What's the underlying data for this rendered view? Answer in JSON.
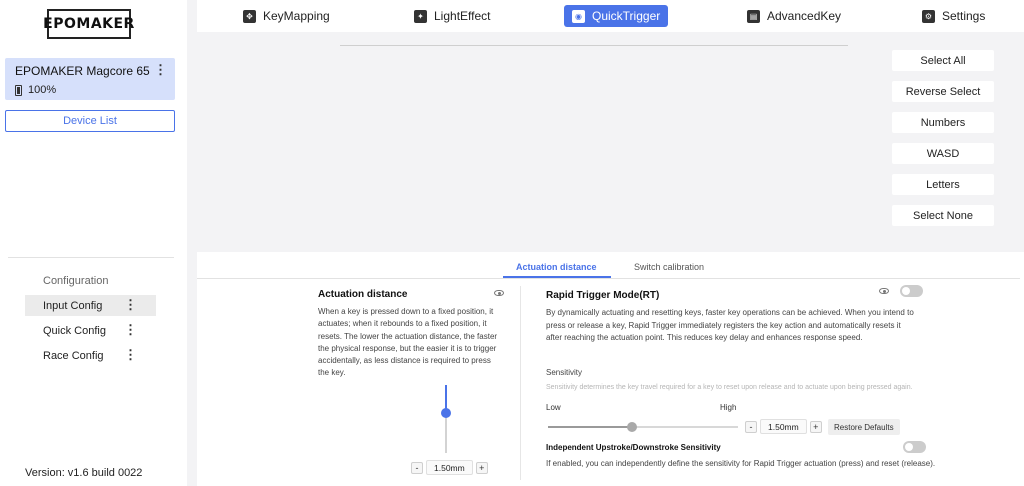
{
  "sidebar": {
    "logo": "EPOMAKER",
    "device": {
      "name": "EPOMAKER Magcore 65",
      "battery": "100%"
    },
    "device_list_label": "Device List",
    "config_title": "Configuration",
    "configs": [
      {
        "label": "Input Config"
      },
      {
        "label": "Quick Config"
      },
      {
        "label": "Race Config"
      }
    ],
    "version": "Version: v1.6 build 0022"
  },
  "nav": {
    "tabs": [
      {
        "label": "KeyMapping",
        "icon": "keymapping-icon"
      },
      {
        "label": "LightEffect",
        "icon": "lighteffect-icon"
      },
      {
        "label": "QuickTrigger",
        "icon": "quicktrigger-icon"
      },
      {
        "label": "AdvancedKey",
        "icon": "keyboard-icon"
      },
      {
        "label": "Settings",
        "icon": "gear-icon"
      }
    ],
    "active": "QuickTrigger"
  },
  "selection": {
    "buttons": [
      "Select All",
      "Reverse Select",
      "Numbers",
      "WASD",
      "Letters",
      "Select None"
    ]
  },
  "subtabs": [
    "Actuation distance",
    "Switch calibration"
  ],
  "actuation": {
    "title": "Actuation distance",
    "description": "When a key is pressed down to a fixed position, it actuates; when it rebounds to a fixed position, it resets. The lower the actuation distance, the faster the physical response, but the easier it is to trigger accidentally, as less distance is required to press the key.",
    "value": "1.50mm",
    "level": 0.42
  },
  "rapid_trigger": {
    "title": "Rapid Trigger Mode(RT)",
    "description": "By dynamically actuating and resetting keys, faster key operations can be achieved. When you intend to press or release a key, Rapid Trigger immediately registers the key action and automatically resets it after reaching the actuation point. This reduces key delay and enhances response speed.",
    "enabled": false,
    "sensitivity_label": "Sensitivity",
    "sensitivity_desc": "Sensitivity determines the key travel required for a key to reset upon release and to actuate upon being pressed again.",
    "low": "Low",
    "high": "High",
    "sensitivity_value": "1.50mm",
    "restore": "Restore Defaults",
    "independent_title": "Independent Upstroke/Downstroke Sensitivity",
    "independent_desc": "If enabled, you can independently define the sensitivity for Rapid Trigger actuation (press) and reset (release).",
    "independent_enabled": false
  },
  "colors": {
    "accent": "#4a73e8",
    "device_card": "#d6e0fb"
  }
}
